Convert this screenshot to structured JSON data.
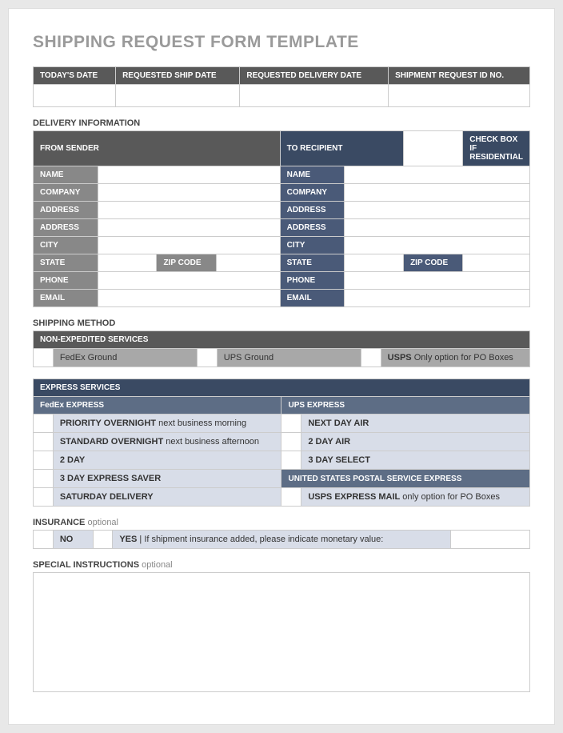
{
  "title": "SHIPPING REQUEST FORM TEMPLATE",
  "top": {
    "todays_date": "TODAY'S DATE",
    "req_ship_date": "REQUESTED SHIP DATE",
    "req_delivery_date": "REQUESTED DELIVERY DATE",
    "shipment_req_id": "SHIPMENT REQUEST ID NO."
  },
  "delivery": {
    "section": "DELIVERY INFORMATION",
    "from_sender": "FROM SENDER",
    "to_recipient": "TO RECIPIENT",
    "check_residential": "CHECK BOX IF RESIDENTIAL",
    "labels": {
      "name": "NAME",
      "company": "COMPANY",
      "address": "ADDRESS",
      "city": "CITY",
      "state": "STATE",
      "zip": "ZIP CODE",
      "phone": "PHONE",
      "email": "EMAIL"
    }
  },
  "shipping": {
    "section": "SHIPPING METHOD",
    "non_exp": "NON-EXPEDITED SERVICES",
    "fedex_ground": "FedEx Ground",
    "ups_ground": "UPS Ground",
    "usps_label": "USPS",
    "usps_note": " Only option for PO Boxes"
  },
  "express": {
    "header": "EXPRESS SERVICES",
    "fedex": "FedEx EXPRESS",
    "ups": "UPS EXPRESS",
    "priority_b": "PRIORITY OVERNIGHT",
    "priority_n": " next business morning",
    "standard_b": "STANDARD OVERNIGHT",
    "standard_n": " next business afternoon",
    "two_day": "2 DAY",
    "three_day_saver": "3 DAY EXPRESS SAVER",
    "saturday": "SATURDAY DELIVERY",
    "next_day_air": "NEXT DAY AIR",
    "two_day_air": "2 DAY AIR",
    "three_day_select": "3 DAY SELECT",
    "usps_express_hdr": "UNITED STATES POSTAL SERVICE EXPRESS",
    "usps_mail_b": "USPS EXPRESS MAIL",
    "usps_mail_n": " only option for PO Boxes"
  },
  "insurance": {
    "section": "INSURANCE",
    "opt": " optional",
    "no": "NO",
    "yes": "YES",
    "note": "   |   If shipment insurance added, please indicate monetary value:"
  },
  "special": {
    "section": "SPECIAL INSTRUCTIONS",
    "opt": " optional"
  }
}
